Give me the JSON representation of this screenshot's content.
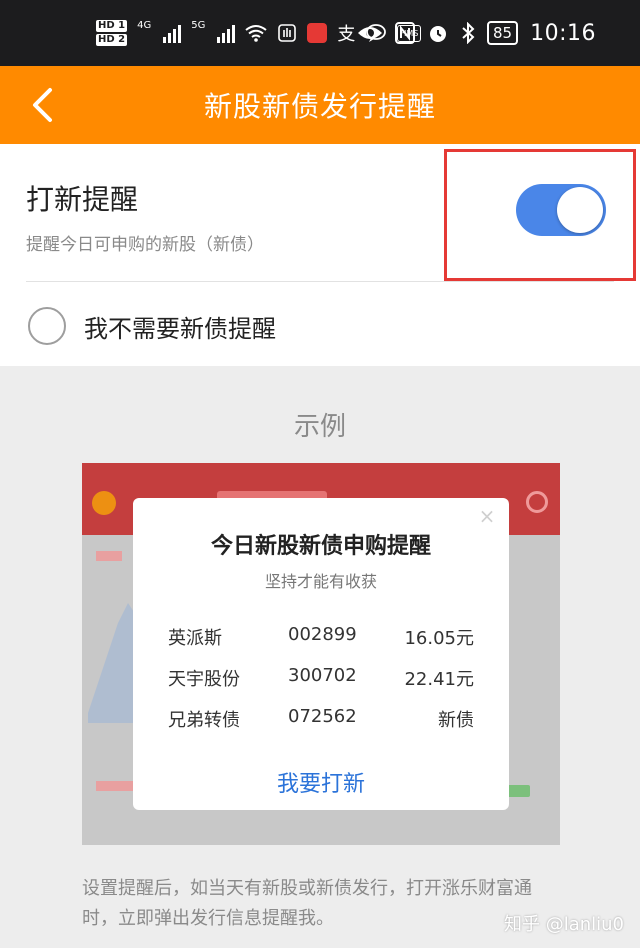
{
  "status_bar": {
    "hd1": "HD 1",
    "hd2": "HD 2",
    "net1": "4G",
    "net2": "5G",
    "alipay_glyph": "支",
    "hms": "HMS",
    "battery": "85",
    "time": "10:16",
    "icons": [
      "signal-icon",
      "wifi-icon",
      "hand-icon",
      "app-icon",
      "alipay-icon",
      "chat-icon",
      "eye-icon",
      "nfc-icon",
      "alarm-icon",
      "bluetooth-icon",
      "battery-icon"
    ]
  },
  "header": {
    "title": "新股新债发行提醒",
    "back_icon": "chevron-left-icon",
    "background": "#ff8a00"
  },
  "settings": {
    "reminder_title": "打新提醒",
    "reminder_subtitle": "提醒今日可申购的新股（新债）",
    "toggle_on": true,
    "toggle_color": "#4a86e8",
    "no_bond_label": "我不需要新债提醒",
    "no_bond_checked": false
  },
  "example": {
    "heading": "示例",
    "dialog": {
      "title": "今日新股新债申购提醒",
      "subtitle": "坚持才能有收获",
      "close_glyph": "×",
      "rows": [
        {
          "name": "英派斯",
          "code": "002899",
          "value": "16.05元"
        },
        {
          "name": "天宇股份",
          "code": "300702",
          "value": "22.41元"
        },
        {
          "name": "兄弟转债",
          "code": "072562",
          "value": "新债"
        }
      ],
      "action": "我要打新"
    }
  },
  "description": "设置提醒后，如当天有新股或新债发行，打开涨乐财富通时，立即弹出发行信息提醒我。",
  "watermark": "知乎 @lanliu0"
}
